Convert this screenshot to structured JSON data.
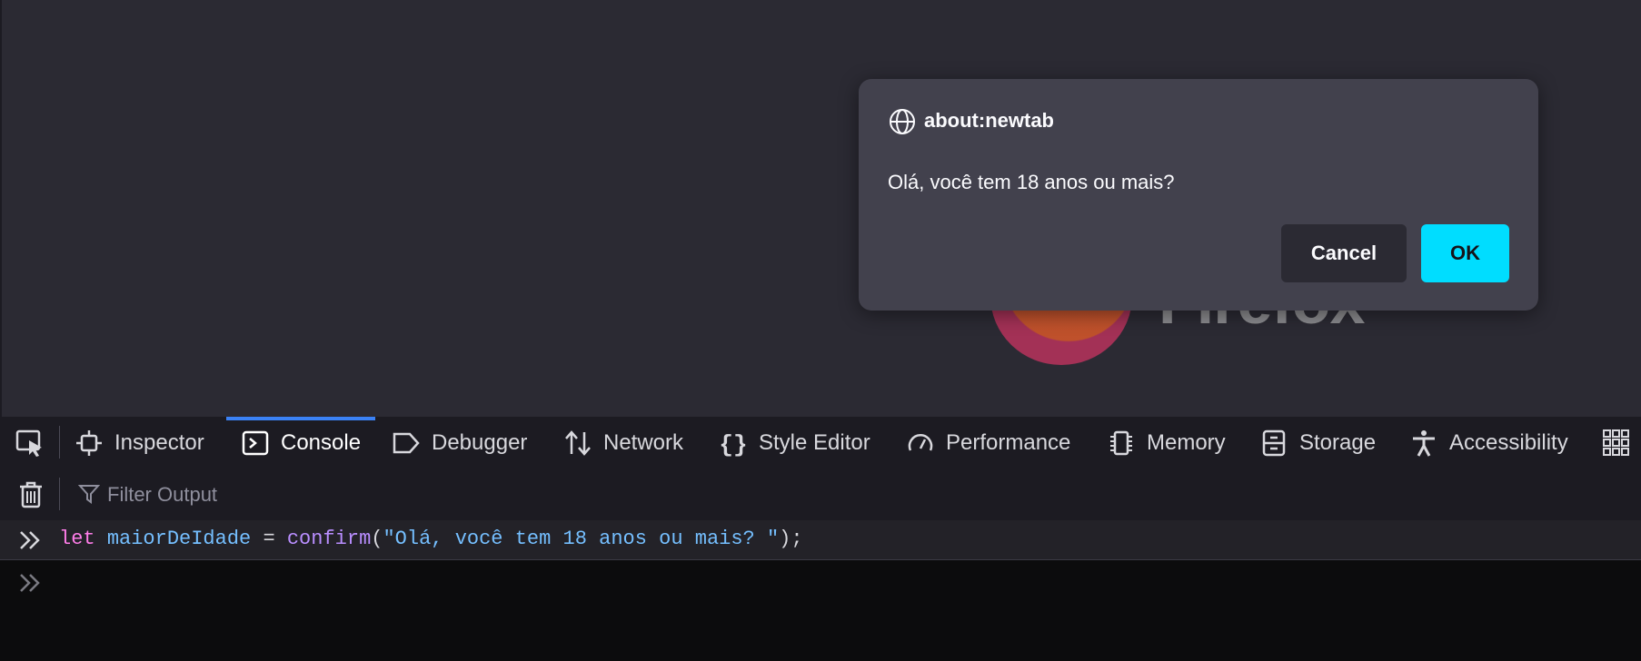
{
  "page": {
    "logo_word": "Firefox"
  },
  "dialog": {
    "origin": "about:newtab",
    "message": "Olá, você tem 18 anos ou mais?",
    "cancel_label": "Cancel",
    "ok_label": "OK"
  },
  "devtools": {
    "tabs": [
      {
        "label": "Inspector",
        "icon": "inspector-icon"
      },
      {
        "label": "Console",
        "icon": "console-icon",
        "active": true
      },
      {
        "label": "Debugger",
        "icon": "debugger-icon"
      },
      {
        "label": "Network",
        "icon": "network-icon"
      },
      {
        "label": "Style Editor",
        "icon": "style-editor-icon"
      },
      {
        "label": "Performance",
        "icon": "performance-icon"
      },
      {
        "label": "Memory",
        "icon": "memory-icon"
      },
      {
        "label": "Storage",
        "icon": "storage-icon"
      },
      {
        "label": "Accessibility",
        "icon": "accessibility-icon"
      }
    ],
    "filter_placeholder": "Filter Output",
    "console_entry": {
      "kw": "let",
      "var": "maiorDeIdade",
      "op": " = ",
      "fn": "confirm",
      "open": "(",
      "str": "\"Olá, você tem 18 anos ou mais? \"",
      "close": ");"
    }
  },
  "colors": {
    "accent": "#00ddff",
    "active_tab_indicator": "#3b82f6"
  }
}
